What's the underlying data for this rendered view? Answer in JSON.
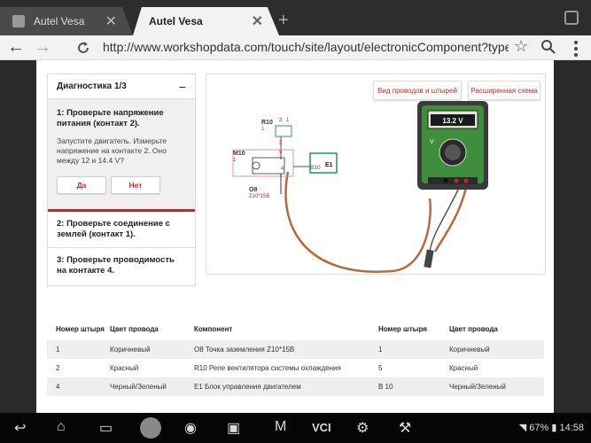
{
  "tabs": [
    {
      "title": "Autel Vesa",
      "active": false
    },
    {
      "title": "Autel Vesa",
      "active": true
    }
  ],
  "toolbar": {
    "url": "http://www.workshopdata.com/touch/site/layout/electronicComponent?typeId=t_"
  },
  "panel": {
    "title": "Диагностика 1/3",
    "collapse": "−",
    "step1_title": "1: Проверьте напряжение питания (контакт 2).",
    "step1_text": "Запустите двигатель. Измерьте напряжение на контакте 2. Оно между 12 и 14.4 V?",
    "yes": "Да",
    "no": "Нет",
    "step2": "2: Проверьте соединение с землей (контакт 1).",
    "step3": "3: Проверьте проводимость на контакте 4."
  },
  "diagram": {
    "btn_wires": "Вид проводов и штырей",
    "btn_expanded": "Расширенная схема",
    "labels": {
      "r10": "R10",
      "r10_sub": "1",
      "m10": "M10",
      "m10_sub": "1",
      "o8": "O8",
      "o8_sub": "Z10*15B",
      "e1": "E1",
      "b10": "B10",
      "pin3": "3",
      "pin1": "1",
      "pin2": "2",
      "pin5": "5",
      "pin4": "4"
    },
    "meter_reading": "13.2 V",
    "meter_unit": "V"
  },
  "table": {
    "headers": [
      "Номер штыря",
      "Цвет провода",
      "Компонент",
      "Номер штыря",
      "Цвет провода"
    ],
    "rows": [
      [
        "1",
        "Коричневый",
        "O8 Точка заземления Z10*15B",
        "1",
        "Коричневый"
      ],
      [
        "2",
        "Красный",
        "R10 Реле вентилятора системы охлаждения",
        "5",
        "Красный"
      ],
      [
        "4",
        "Черный/Зеленый",
        "E1 Блок управления двигателем",
        "B 10",
        "Черный/Зеленый"
      ]
    ]
  },
  "statusbar": {
    "vci": "VCI",
    "battery": "67%",
    "time": "14:58"
  },
  "colors": {
    "accent": "#c62828",
    "meter_body": "#3a3a3a",
    "meter_green": "#3e8e3e",
    "e1_green": "#1e9e3a",
    "wire": "#b56a3d"
  }
}
